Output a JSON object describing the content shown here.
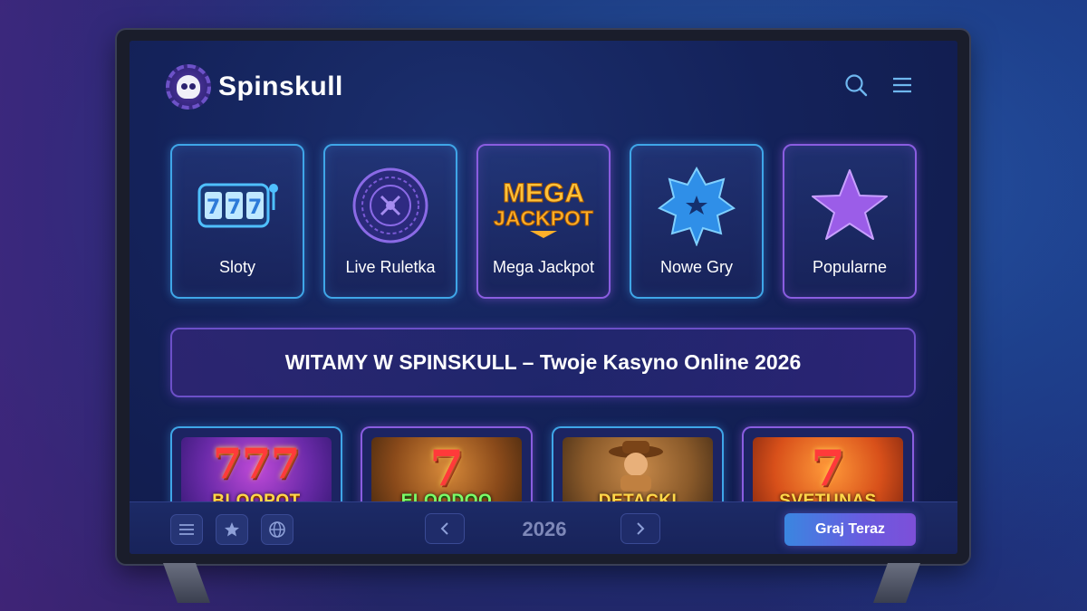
{
  "app": {
    "title": "Spinskull"
  },
  "header": {
    "search_icon": "search-icon",
    "menu_icon": "hamburger-menu-icon"
  },
  "categories": [
    {
      "label": "Sloty",
      "icon": "slot-machine-icon"
    },
    {
      "label": "Live Ruletka",
      "icon": "roulette-wheel-icon"
    },
    {
      "label": "Mega Jackpot",
      "icon": "mega-jackpot-icon",
      "art_line1": "MEGA",
      "art_line2": "JACKPOT"
    },
    {
      "label": "Nowe Gry",
      "icon": "star-badge-icon"
    },
    {
      "label": "Popularne",
      "icon": "star-icon"
    }
  ],
  "banner": {
    "text": "WITAMY W SPINSKULL – Twoje Kasyno Online 2026"
  },
  "games": [
    {
      "seven": "777",
      "name": "BLOOPOT"
    },
    {
      "seven": "7",
      "name": "ELOODOO"
    },
    {
      "seven": "",
      "name": "DETACKI"
    },
    {
      "seven": "7",
      "name": "SVETUNAS"
    }
  ],
  "bottom_bar": {
    "year": "2026",
    "play_label": "Graj Teraz",
    "left_icons": [
      "menu-icon",
      "star-icon",
      "globe-icon"
    ]
  },
  "colors": {
    "accent_blue": "#3fa6e8",
    "accent_purple": "#8a5de0",
    "jackpot_gold": "#ffc23a",
    "play_gradient_start": "#3a86e0",
    "play_gradient_end": "#7d4fd8"
  }
}
